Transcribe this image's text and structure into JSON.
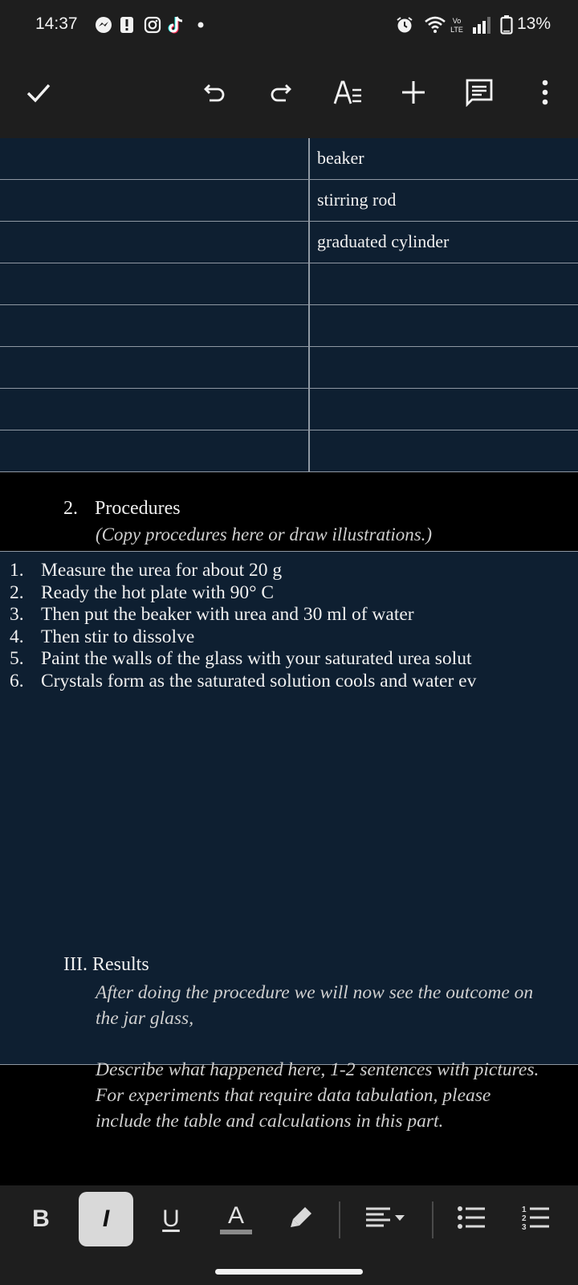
{
  "status_bar": {
    "time": "14:37",
    "battery_percent": "13%",
    "notification_icons": [
      "messenger-icon",
      "alert-icon",
      "instagram-icon",
      "tiktok-icon",
      "dot-icon"
    ],
    "system_icons": [
      "alarm-icon",
      "wifi-icon",
      "volte-icon",
      "signal-icon",
      "battery-icon"
    ]
  },
  "toolbar": {
    "icons": [
      "check-icon",
      "undo-icon",
      "redo-icon",
      "text-format-icon",
      "insert-icon",
      "comment-icon",
      "more-icon"
    ]
  },
  "materials_table": {
    "rows": [
      {
        "left": "",
        "right": "beaker"
      },
      {
        "left": "",
        "right": "stirring rod"
      },
      {
        "left": "",
        "right": "graduated cylinder"
      },
      {
        "left": "",
        "right": ""
      },
      {
        "left": "",
        "right": ""
      },
      {
        "left": "",
        "right": ""
      },
      {
        "left": "",
        "right": ""
      },
      {
        "left": "",
        "right": ""
      }
    ]
  },
  "procedures": {
    "number": "2.",
    "title": "Procedures",
    "note": "(Copy procedures here or draw illustrations.)",
    "steps": [
      {
        "n": "1.",
        "text": "Measure the urea for about 20 g"
      },
      {
        "n": "2.",
        "text": "Ready the hot plate with 90° C"
      },
      {
        "n": "3.",
        "text": "Then put the beaker with urea and 30 ml of water"
      },
      {
        "n": "4.",
        "text": "Then stir to dissolve"
      },
      {
        "n": "5.",
        "text": "Paint the walls of the glass with your saturated urea solut"
      },
      {
        "n": "6.",
        "text": "Crystals form as the saturated solution cools and water ev"
      }
    ]
  },
  "results": {
    "title": "III. Results",
    "line1": " After doing the procedure we will now see the outcome on the jar glass,",
    "line2": "Describe what happened here, 1-2 sentences with pictures. For experiments that require data tabulation, please include the table and calculations in this part."
  },
  "format_bar": {
    "bold": "B",
    "italic": "I",
    "underline": "U",
    "text_color": "A",
    "active": "italic"
  },
  "colors": {
    "background": "#000000",
    "bars": "#1e1e1e",
    "table_fill": "#0e1f31",
    "grid_lines": "#8f98a3"
  }
}
